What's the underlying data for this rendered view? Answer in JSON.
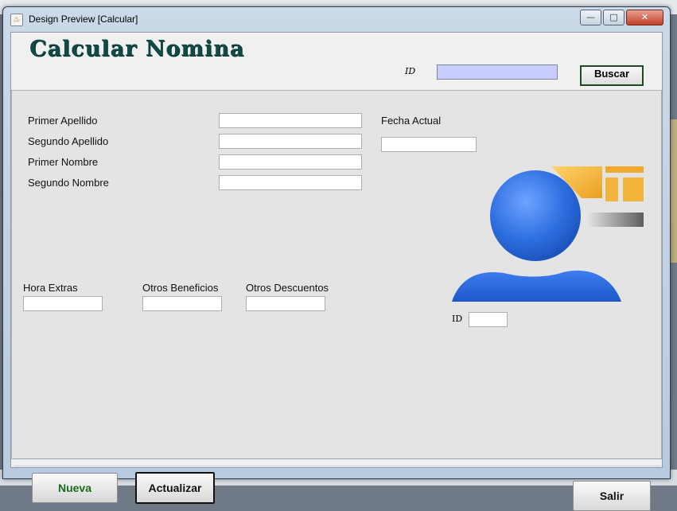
{
  "window": {
    "title": "Design Preview [Calcular]",
    "buttons": {
      "minimize": "—",
      "maximize": "□",
      "close": "✕"
    },
    "app_icon": "java-app-icon"
  },
  "header": {
    "title": "Calcular Nomina",
    "id_label": "ID",
    "id_value": "",
    "search_button": "Buscar"
  },
  "form": {
    "primer_apellido_label": "Primer Apellido",
    "segundo_apellido_label": "Segundo Apellido",
    "primer_nombre_label": "Primer Nombre",
    "segundo_nombre_label": "Segundo Nombre",
    "fecha_actual_label": "Fecha Actual",
    "hora_extras_label": "Hora Extras",
    "otros_beneficios_label": "Otros Beneficios",
    "otros_descuentos_label": "Otros Descuentos",
    "mini_id_label": "ID"
  },
  "values": {
    "primer_apellido": "",
    "segundo_apellido": "",
    "primer_nombre": "",
    "segundo_nombre": "",
    "fecha_actual": "",
    "hora_extras": "",
    "otros_beneficios": "",
    "otros_descuentos": "",
    "mini_id": ""
  },
  "actions": {
    "nueva": "Nueva",
    "actualizar": "Actualizar",
    "salir": "Salir"
  },
  "colors": {
    "title": "#0f4a45",
    "search_bg": "#c8ccff",
    "nueva_text": "#1c6a1c",
    "user_icon": "#2d6fe0",
    "logo_accent": "#f2b43a"
  },
  "icons": {
    "user_avatar": "user-silhouette-icon",
    "logo": "company-logo"
  }
}
